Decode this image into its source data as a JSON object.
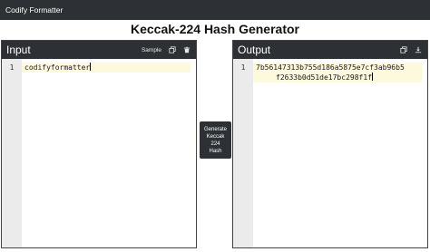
{
  "app": {
    "title": "Codify Formatter"
  },
  "page": {
    "title": "Keccak-224 Hash Generator"
  },
  "input": {
    "title": "Input",
    "sample_label": "Sample",
    "line_number": "1",
    "value": "codifyformatter"
  },
  "generate": {
    "lines": [
      "Generate",
      "Keccak",
      "224",
      "Hash"
    ]
  },
  "output": {
    "title": "Output",
    "line_number": "1",
    "value_line1": "7b56147313b755d186a5875e7cf3ab96b5",
    "value_line2": "f2633b0d51de17bc298f1f"
  },
  "icons": {
    "input_copy": "copy-icon",
    "input_delete": "trash-icon",
    "output_copy": "copy-icon",
    "output_download": "download-icon"
  },
  "colors": {
    "header_bg": "#2d3034",
    "active_line": "#fdf9dd",
    "gutter": "#ebebeb"
  }
}
